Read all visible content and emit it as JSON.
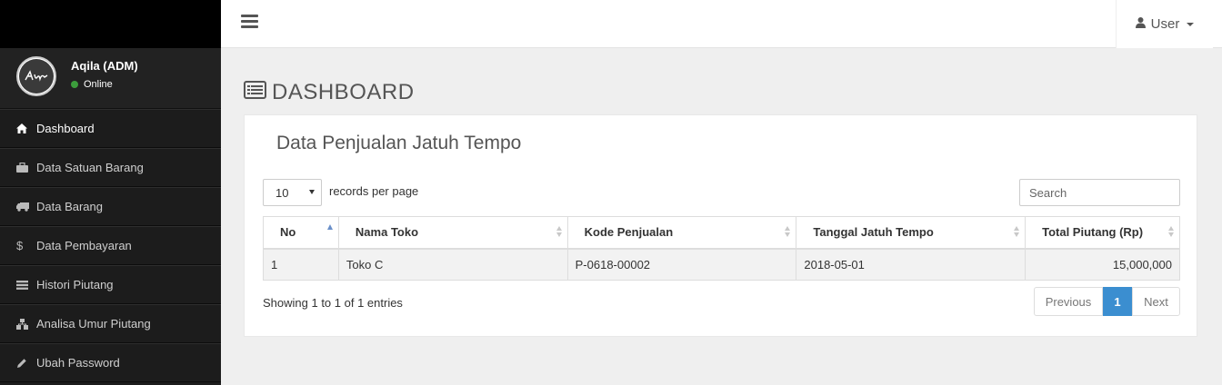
{
  "user_panel": {
    "name": "Aqila (ADM)",
    "status": "Online",
    "status_color": "#3c9d3c"
  },
  "sidebar": {
    "items": [
      {
        "label": "Dashboard",
        "icon": "home-icon",
        "active": true
      },
      {
        "label": "Data Satuan Barang",
        "icon": "briefcase-icon"
      },
      {
        "label": "Data Barang",
        "icon": "truck-icon"
      },
      {
        "label": "Data Pembayaran",
        "icon": "dollar-icon"
      },
      {
        "label": "Histori Piutang",
        "icon": "list-icon"
      },
      {
        "label": "Analisa Umur Piutang",
        "icon": "sitemap-icon"
      },
      {
        "label": "Ubah Password",
        "icon": "pencil-icon"
      }
    ]
  },
  "navbar": {
    "user_label": "User",
    "menu_icon": "bars-icon",
    "user_icon": "user-icon"
  },
  "page": {
    "title": "DASHBOARD",
    "title_icon": "list-alt-icon"
  },
  "panel": {
    "heading": "Data Penjualan Jatuh Tempo",
    "length": {
      "value": "10",
      "label": "records per page"
    },
    "search": {
      "placeholder": "Search"
    },
    "table": {
      "headers": [
        "No",
        "Nama Toko",
        "Kode Penjualan",
        "Tanggal Jatuh Tempo",
        "Total Piutang (Rp)"
      ],
      "rows": [
        [
          "1",
          "Toko C",
          "P-0618-00002",
          "2018-05-01",
          "15,000,000"
        ]
      ]
    },
    "info": "Showing 1 to 1 of 1 entries",
    "pagination": {
      "previous": "Previous",
      "current": "1",
      "next": "Next"
    }
  },
  "colors": {
    "sidebar_bg": "#1c1c1c",
    "accent": "#3b8ed0"
  }
}
